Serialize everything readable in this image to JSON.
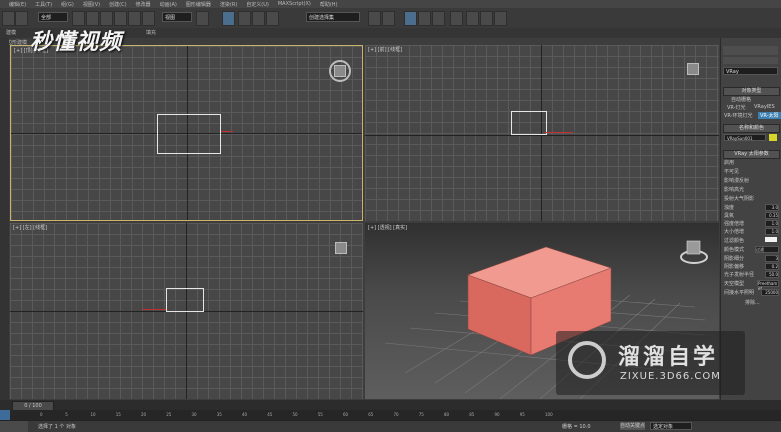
{
  "menubar": {
    "items": [
      "编辑(E)",
      "工具(T)",
      "组(G)",
      "视图(V)",
      "创建(C)",
      "修改器",
      "动画(A)",
      "图形编辑器",
      "渲染(R)",
      "自定义(U)",
      "MAXScript(X)",
      "帮助(H)"
    ]
  },
  "toolbar": {
    "filter_value": "全部",
    "view_value": "视图",
    "selection_set_value": "创建选择集"
  },
  "ribbon": {
    "tab1": "建模",
    "tab2": "多边形建模",
    "tab3": "填充"
  },
  "viewports": {
    "top_label": "[+] [顶] [线框]",
    "front_label": "[+] [前] [线框]",
    "left_label": "[+] [左] [线框]",
    "persp_label": "[+] [透视] [真实]"
  },
  "command_panel": {
    "renderer_dropdown": "VRay",
    "object_type_header": "对象类型",
    "auto_grid": "自动栅格",
    "btn_vr_light": "VR-灯光",
    "btn_vray_ies": "VRayIES",
    "btn_vr_env_light": "VR-环境灯光",
    "btn_vr_sun": "VR-太阳",
    "name_color_header": "名称和颜色",
    "name_value": "VRaySun001",
    "params_header": "VRay 太阳参数",
    "params": [
      {
        "label": "启用",
        "value": ""
      },
      {
        "label": "不可见",
        "value": ""
      },
      {
        "label": "影响漫反射",
        "value": ""
      },
      {
        "label": "影响高光",
        "value": ""
      },
      {
        "label": "投射大气阴影",
        "value": ""
      },
      {
        "label": "浊度",
        "value": "3.0"
      },
      {
        "label": "臭氧",
        "value": "0.35"
      },
      {
        "label": "强度倍增",
        "value": "1.0"
      },
      {
        "label": "大小倍增",
        "value": "1.0"
      },
      {
        "label": "过滤颜色",
        "value": ""
      },
      {
        "label": "颜色模式",
        "value": "过滤"
      },
      {
        "label": "阴影细分",
        "value": "3"
      },
      {
        "label": "阴影偏移",
        "value": "0.2"
      },
      {
        "label": "光子发射半径",
        "value": "50.0"
      },
      {
        "label": "天空模型",
        "value": "Preetham et"
      },
      {
        "label": "间接水平照明",
        "value": "25000"
      }
    ],
    "exclude_button": "排除..."
  },
  "timeline": {
    "frame_counter": "0 / 100"
  },
  "ruler": {
    "ticks": [
      "0",
      "5",
      "10",
      "15",
      "20",
      "25",
      "30",
      "35",
      "40",
      "45",
      "50",
      "55",
      "60",
      "65",
      "70",
      "75",
      "80",
      "85",
      "90",
      "95",
      "100"
    ]
  },
  "statusbar": {
    "selection_text": "选择了 1 个 对象",
    "grid_text": "栅格 = 10.0",
    "auto_key": "自动关键点",
    "selected_dropdown": "选定对象"
  },
  "logo": {
    "text": "秒懂视频"
  },
  "watermark": {
    "title": "溜溜自学",
    "url": "ZIXUE.3D66.COM"
  },
  "colors": {
    "box": "#e77b72",
    "viewport": "#474747",
    "accent": "#3c7fb1"
  }
}
